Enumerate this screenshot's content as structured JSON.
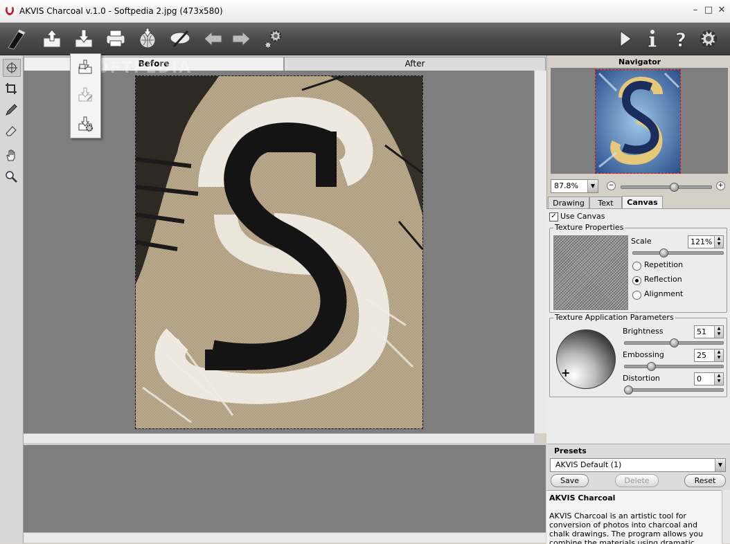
{
  "window": {
    "title": "AKVIS Charcoal v.1.0 - Softpedia 2.jpg (473x580)",
    "minimize": "–",
    "maximize": "□",
    "close": "✕"
  },
  "toolbar": {
    "icons": [
      "charcoal-logo-icon",
      "open-icon",
      "save-icon",
      "print-icon",
      "share-icon",
      "settings-eye-icon",
      "undo-icon",
      "redo-icon",
      "gear-small-icon",
      "run-icon",
      "info-icon",
      "help-icon",
      "preferences-icon"
    ]
  },
  "tools": [
    "move-tool-icon",
    "crop-tool-icon",
    "pencil-tool-icon",
    "eraser-tool-icon",
    "hand-tool-icon",
    "zoom-tool-icon"
  ],
  "canvas": {
    "tab_before": "Before",
    "tab_after": "After",
    "watermark": "SOFTPEDIA"
  },
  "navigator": {
    "title": "Navigator",
    "zoom": "87.8%",
    "zoom_minus": "−",
    "zoom_plus": "+",
    "zoom_level": 0.6
  },
  "settings_tabs": {
    "drawing": "Drawing",
    "text": "Text",
    "canvas": "Canvas",
    "active": "Canvas"
  },
  "canvas_settings": {
    "use_canvas_label": "Use Canvas",
    "use_canvas": true,
    "texture_properties": "Texture Properties",
    "scale_label": "Scale",
    "scale_value": "121%",
    "scale_level": 0.33,
    "repetition": "Repetition",
    "reflection": "Reflection",
    "alignment": "Alignment",
    "selected_mode": "Reflection",
    "texture_application": "Texture Application Parameters",
    "brightness_label": "Brightness",
    "brightness_value": "51",
    "brightness_level": 0.51,
    "embossing_label": "Embossing",
    "embossing_value": "25",
    "embossing_level": 0.25,
    "distortion_label": "Distortion",
    "distortion_value": "0",
    "distortion_level": 0.0
  },
  "presets": {
    "title": "Presets",
    "selected": "AKVIS Default (1)",
    "save": "Save",
    "delete": "Delete",
    "reset": "Reset"
  },
  "description": {
    "title": "AKVIS Charcoal",
    "text": "AKVIS Charcoal is an artistic tool for conversion of photos into charcoal and chalk drawings. The program allows you combine the materials using dramatic contrast between black and white"
  },
  "colors": {
    "toolbar_dark": "#3b3b3b",
    "workspace_gray": "#7e7e7e",
    "paper_tan": "#b7a588",
    "charcoal_black": "#1a1a1a"
  }
}
